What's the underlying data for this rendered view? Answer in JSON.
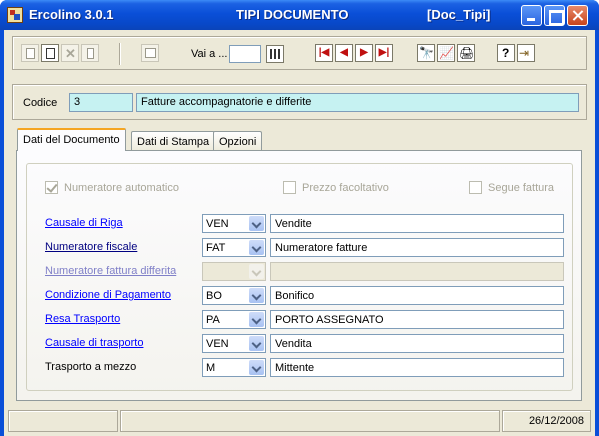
{
  "window": {
    "app_title": "Ercolino 3.0.1",
    "center_title": "TIPI DOCUMENTO",
    "table_name": "[Doc_Tipi]"
  },
  "toolbar": {
    "vai_a_label": "Vai a ...",
    "vai_a_value": ""
  },
  "record": {
    "codice_label": "Codice",
    "codice_value": "3",
    "descrizione_value": "Fatture accompagnatorie e differite"
  },
  "tabs": [
    {
      "label": "Dati del Documento",
      "active": true
    },
    {
      "label": "Dati di Stampa",
      "active": false
    },
    {
      "label": "Opzioni",
      "active": false
    }
  ],
  "checkboxes": {
    "numeratore_automatico": {
      "label": "Numeratore automatico",
      "checked": true
    },
    "prezzo_facoltativo": {
      "label": "Prezzo facoltativo",
      "checked": false
    },
    "segue_fattura": {
      "label": "Segue fattura",
      "checked": false
    }
  },
  "fields": [
    {
      "label": "Causale di Riga",
      "code": "VEN",
      "description": "Vendite"
    },
    {
      "label": "Numeratore fiscale",
      "code": "FAT",
      "description": "Numeratore fatture"
    },
    {
      "label": "Numeratore fattura differita",
      "code": "",
      "description": ""
    },
    {
      "label": "Condizione di Pagamento",
      "code": "BO",
      "description": "Bonifico"
    },
    {
      "label": "Resa Trasporto",
      "code": "PA",
      "description": "PORTO ASSEGNATO"
    },
    {
      "label": "Causale di  trasporto",
      "code": "VEN",
      "description": "Vendita"
    },
    {
      "label": "Trasporto a mezzo",
      "code": "M",
      "description": "Mittente"
    }
  ],
  "status": {
    "date": "26/12/2008"
  }
}
